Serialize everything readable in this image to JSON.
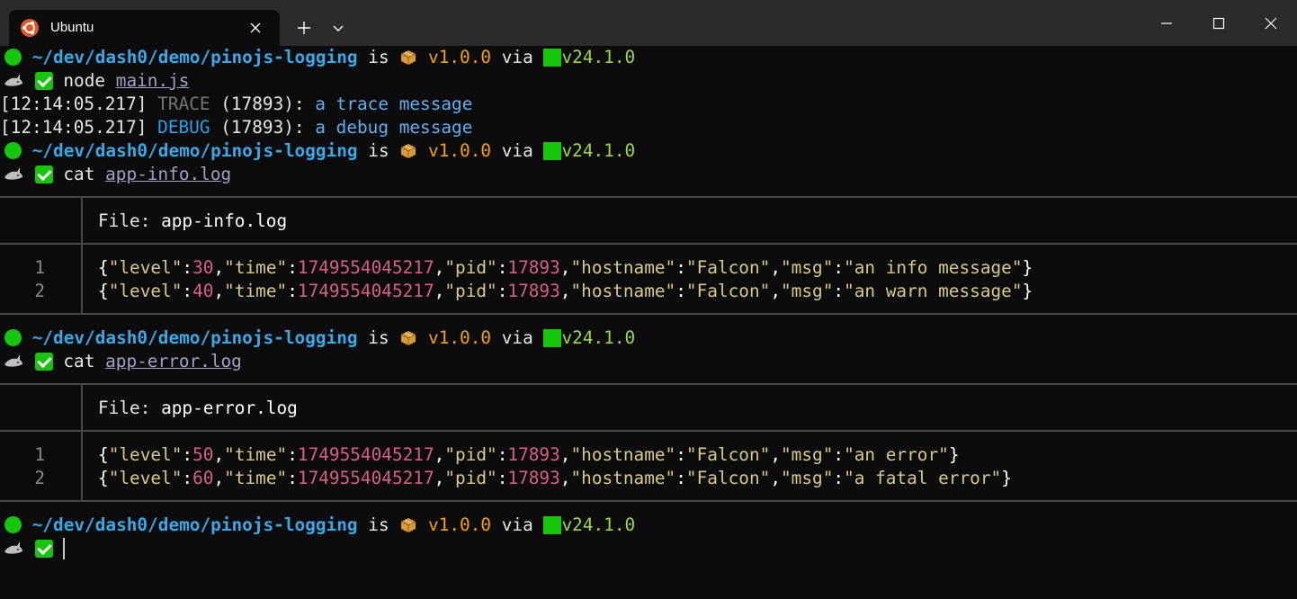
{
  "window": {
    "tab_title": "Ubuntu",
    "icons": {
      "tab": "ubuntu-logo-icon",
      "close_tab": "close-icon",
      "new_tab": "plus-icon",
      "dropdown": "chevron-down-icon",
      "minimize": "minimize-icon",
      "maximize": "maximize-icon",
      "close_window": "close-icon"
    }
  },
  "prompt": {
    "path": "~/dev/dash0/demo/pinojs-logging",
    "is": "is",
    "version": "v1.0.0",
    "via": "via",
    "node_version": "v24.1.0"
  },
  "commands": [
    {
      "cmd": "node",
      "arg": "main.js"
    },
    {
      "cmd": "cat",
      "arg": "app-info.log"
    },
    {
      "cmd": "cat",
      "arg": "app-error.log"
    }
  ],
  "output": [
    {
      "time": "[12:14:05.217]",
      "level": "TRACE",
      "pid": "(17893):",
      "msg": "a trace message"
    },
    {
      "time": "[12:14:05.217]",
      "level": "DEBUG",
      "pid": "(17893):",
      "msg": "a debug message"
    }
  ],
  "files": [
    {
      "label": "File:",
      "name": "app-info.log",
      "lines": [
        {
          "num": "1",
          "level": "30",
          "time": "1749554045217",
          "pid": "17893",
          "hostname": "\"Falcon\"",
          "msg": "\"an info message\""
        },
        {
          "num": "2",
          "level": "40",
          "time": "1749554045217",
          "pid": "17893",
          "hostname": "\"Falcon\"",
          "msg": "\"an warn message\""
        }
      ]
    },
    {
      "label": "File:",
      "name": "app-error.log",
      "lines": [
        {
          "num": "1",
          "level": "50",
          "time": "1749554045217",
          "pid": "17893",
          "hostname": "\"Falcon\"",
          "msg": "\"an error\""
        },
        {
          "num": "2",
          "level": "60",
          "time": "1749554045217",
          "pid": "17893",
          "hostname": "\"Falcon\"",
          "msg": "\"a fatal error\""
        }
      ]
    }
  ],
  "json_keys": {
    "level": "\"level\"",
    "time": "\"time\"",
    "pid": "\"pid\"",
    "hostname": "\"hostname\"",
    "msg": "\"msg\""
  },
  "colors": {
    "background": "#0c0c0c",
    "titlebar": "#2b2b2b",
    "path": "#3ba9e8",
    "version": "#f0a30a",
    "node": "#9ed64a",
    "status_ok": "#16c60c",
    "json_number": "#d75f87",
    "json_string": "#d7c98b"
  }
}
